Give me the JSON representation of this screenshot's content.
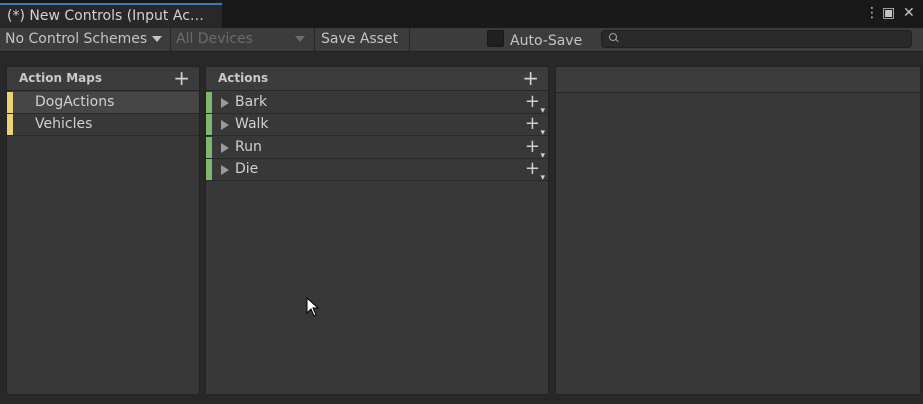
{
  "window": {
    "tab_title": "(*) New Controls (Input Ac…",
    "controls": {
      "menu": "⋮",
      "maximize": "▣",
      "close": "✕"
    },
    "accent_color": "#3a79bb"
  },
  "toolbar": {
    "control_schemes": "No Control Schemes",
    "devices": "All Devices",
    "save_asset": "Save Asset",
    "auto_save": "Auto-Save",
    "search": {
      "value": "",
      "placeholder": ""
    }
  },
  "action_maps": {
    "title": "Action Maps",
    "color": "#e8d27a",
    "items": [
      {
        "label": "DogActions",
        "selected": true
      },
      {
        "label": "Vehicles",
        "selected": false
      }
    ]
  },
  "actions": {
    "title": "Actions",
    "color": "#7fb86d",
    "items": [
      {
        "label": "Bark"
      },
      {
        "label": "Walk"
      },
      {
        "label": "Run"
      },
      {
        "label": "Die"
      }
    ]
  }
}
